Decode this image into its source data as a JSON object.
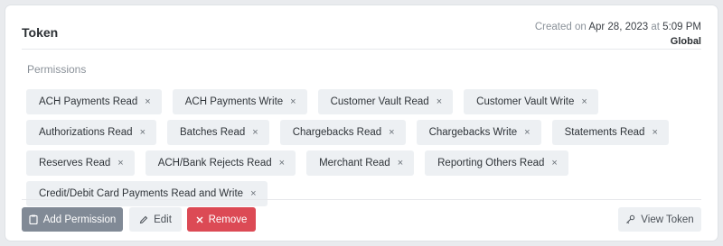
{
  "header": {
    "title": "Token",
    "created_prefix": "Created on",
    "created_date": "Apr 28, 2023",
    "created_at_word": "at",
    "created_time": "5:09 PM",
    "scope": "Global"
  },
  "permissions": {
    "label": "Permissions",
    "remove_glyph": "×",
    "items": [
      "ACH Payments Read",
      "ACH Payments Write",
      "Customer Vault Read",
      "Customer Vault Write",
      "Authorizations Read",
      "Batches Read",
      "Chargebacks Read",
      "Chargebacks Write",
      "Statements Read",
      "Reserves Read",
      "ACH/Bank Rejects Read",
      "Merchant Read",
      "Reporting Others Read",
      "Credit/Debit Card Payments Read and Write"
    ]
  },
  "actions": {
    "add_permission": "Add Permission",
    "edit": "Edit",
    "remove": "Remove",
    "view_token": "View Token"
  },
  "icons": {
    "add_permission": "clipboard-icon",
    "edit": "pencil-icon",
    "remove": "x-icon",
    "view_token": "key-icon"
  },
  "colors": {
    "remove_button": "#dc4a55",
    "add_button": "#818a96",
    "tag_background": "#edf0f3"
  }
}
